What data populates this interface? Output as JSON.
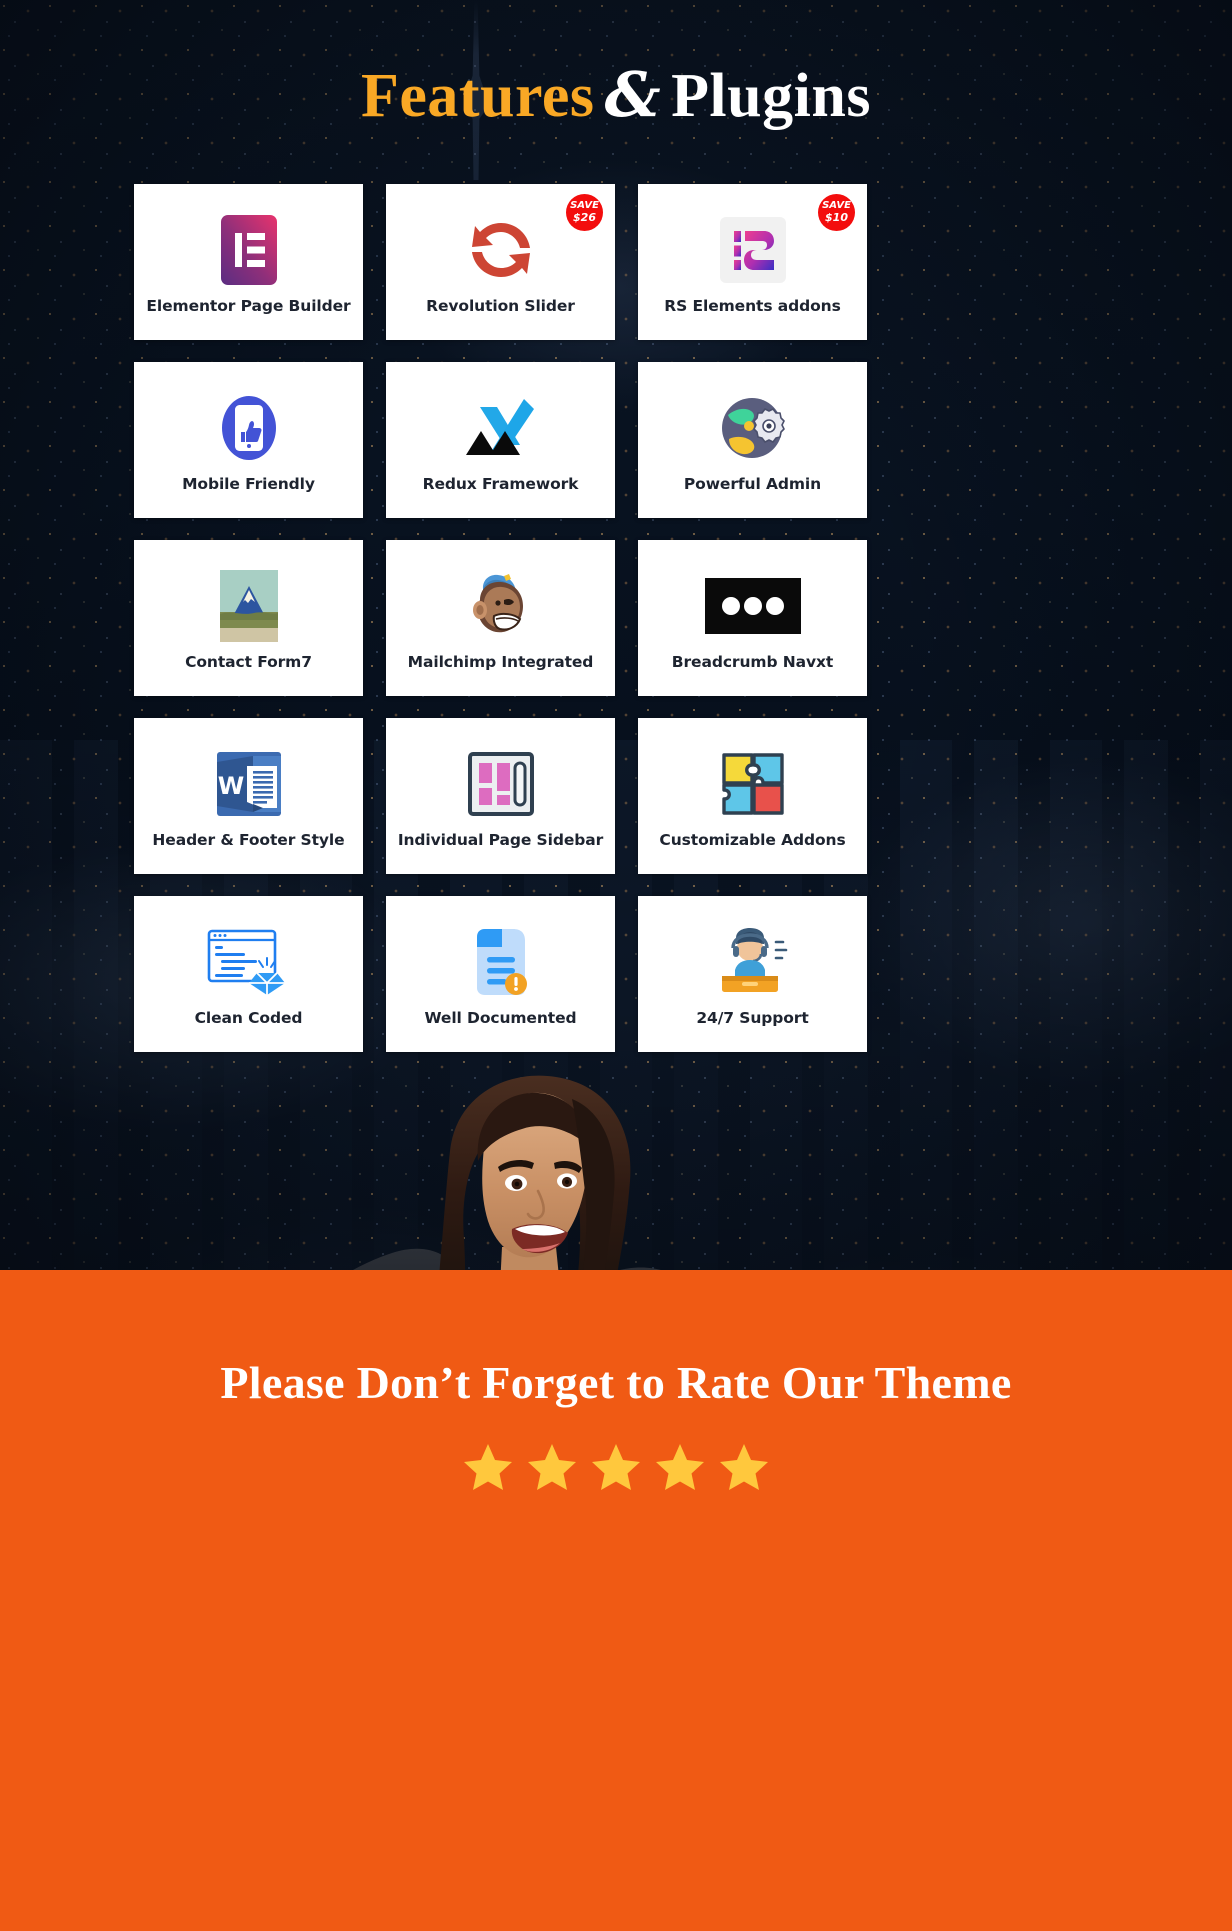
{
  "header": {
    "title_accent": "Features",
    "title_amp": "&",
    "title_rest": "Plugins"
  },
  "colors": {
    "accent_orange": "#f9a825",
    "banner_orange": "#f05a14",
    "badge_red": "#f30d0d",
    "label_dark": "#1e2430",
    "card_bg": "#ffffff",
    "star_yellow": "#ffc83d"
  },
  "features": [
    {
      "label": "Elementor Page Builder",
      "icon": "elementor-icon",
      "badge": null
    },
    {
      "label": "Revolution Slider",
      "icon": "revolution-slider-icon",
      "badge": {
        "line1": "SAVE",
        "line2": "$26"
      }
    },
    {
      "label": "RS Elements addons",
      "icon": "rs-elements-icon",
      "badge": {
        "line1": "SAVE",
        "line2": "$10"
      }
    },
    {
      "label": "Mobile Friendly",
      "icon": "mobile-friendly-icon",
      "badge": null
    },
    {
      "label": "Redux Framework",
      "icon": "redux-framework-icon",
      "badge": null
    },
    {
      "label": "Powerful Admin",
      "icon": "powerful-admin-icon",
      "badge": null
    },
    {
      "label": "Contact Form7",
      "icon": "contact-form7-icon",
      "badge": null
    },
    {
      "label": "Mailchimp Integrated",
      "icon": "mailchimp-icon",
      "badge": null
    },
    {
      "label": "Breadcrumb Navxt",
      "icon": "breadcrumb-navxt-icon",
      "badge": null
    },
    {
      "label": "Header & Footer Style",
      "icon": "word-document-icon",
      "badge": null
    },
    {
      "label": "Individual Page Sidebar",
      "icon": "page-sidebar-icon",
      "badge": null
    },
    {
      "label": "Customizable Addons",
      "icon": "puzzle-addons-icon",
      "badge": null
    },
    {
      "label": "Clean Coded",
      "icon": "clean-code-icon",
      "badge": null
    },
    {
      "label": "Well Documented",
      "icon": "documentation-icon",
      "badge": null
    },
    {
      "label": "24/7 Support",
      "icon": "support-headset-icon",
      "badge": null
    }
  ],
  "banner": {
    "title": "Please Don’t Forget to Rate Our Theme",
    "star_count": 5
  }
}
